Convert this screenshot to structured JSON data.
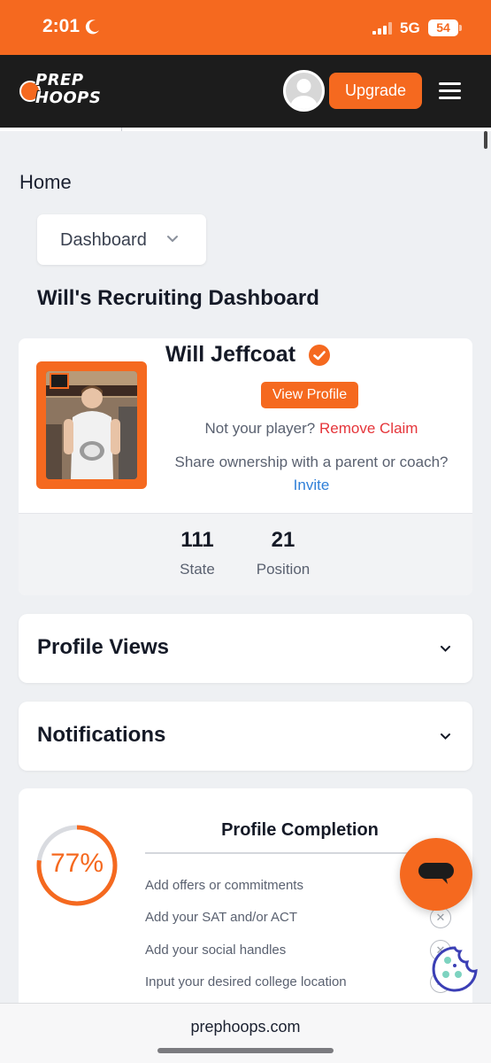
{
  "status_bar": {
    "time": "2:01",
    "network": "5G",
    "battery": "54",
    "icons": [
      "moon-icon",
      "signal-icon"
    ]
  },
  "navbar": {
    "logo": {
      "line1": "PREP",
      "line2": "HOOPS"
    },
    "upgrade_label": "Upgrade",
    "icons": [
      "avatar-icon",
      "hamburger-icon"
    ]
  },
  "breadcrumb": {
    "home": "Home"
  },
  "dashboard_select": {
    "value": "Dashboard"
  },
  "page_title": "Will's Recruiting Dashboard",
  "player": {
    "name": "Will Jeffcoat",
    "view_profile_label": "View Profile",
    "claim_prompt": "Not your player?",
    "remove_claim_label": "Remove Claim",
    "share_prompt": "Share ownership with a parent or coach?",
    "invite_label": "Invite",
    "stats": [
      {
        "value": "111",
        "label": "State"
      },
      {
        "value": "21",
        "label": "Position"
      }
    ]
  },
  "sections": {
    "profile_views": "Profile Views",
    "notifications": "Notifications"
  },
  "profile_completion": {
    "title": "Profile Completion",
    "percent_text": "77%",
    "percent": 77,
    "tasks": [
      "Add offers or commitments",
      "Add your SAT and/or ACT",
      "Add your social handles",
      "Input your desired college location"
    ]
  },
  "url_bar": {
    "url": "prephoops.com"
  },
  "colors": {
    "accent": "#f5691f",
    "navbar": "#1c1c1c",
    "danger": "#e5353a",
    "link": "#2f7fd8"
  }
}
